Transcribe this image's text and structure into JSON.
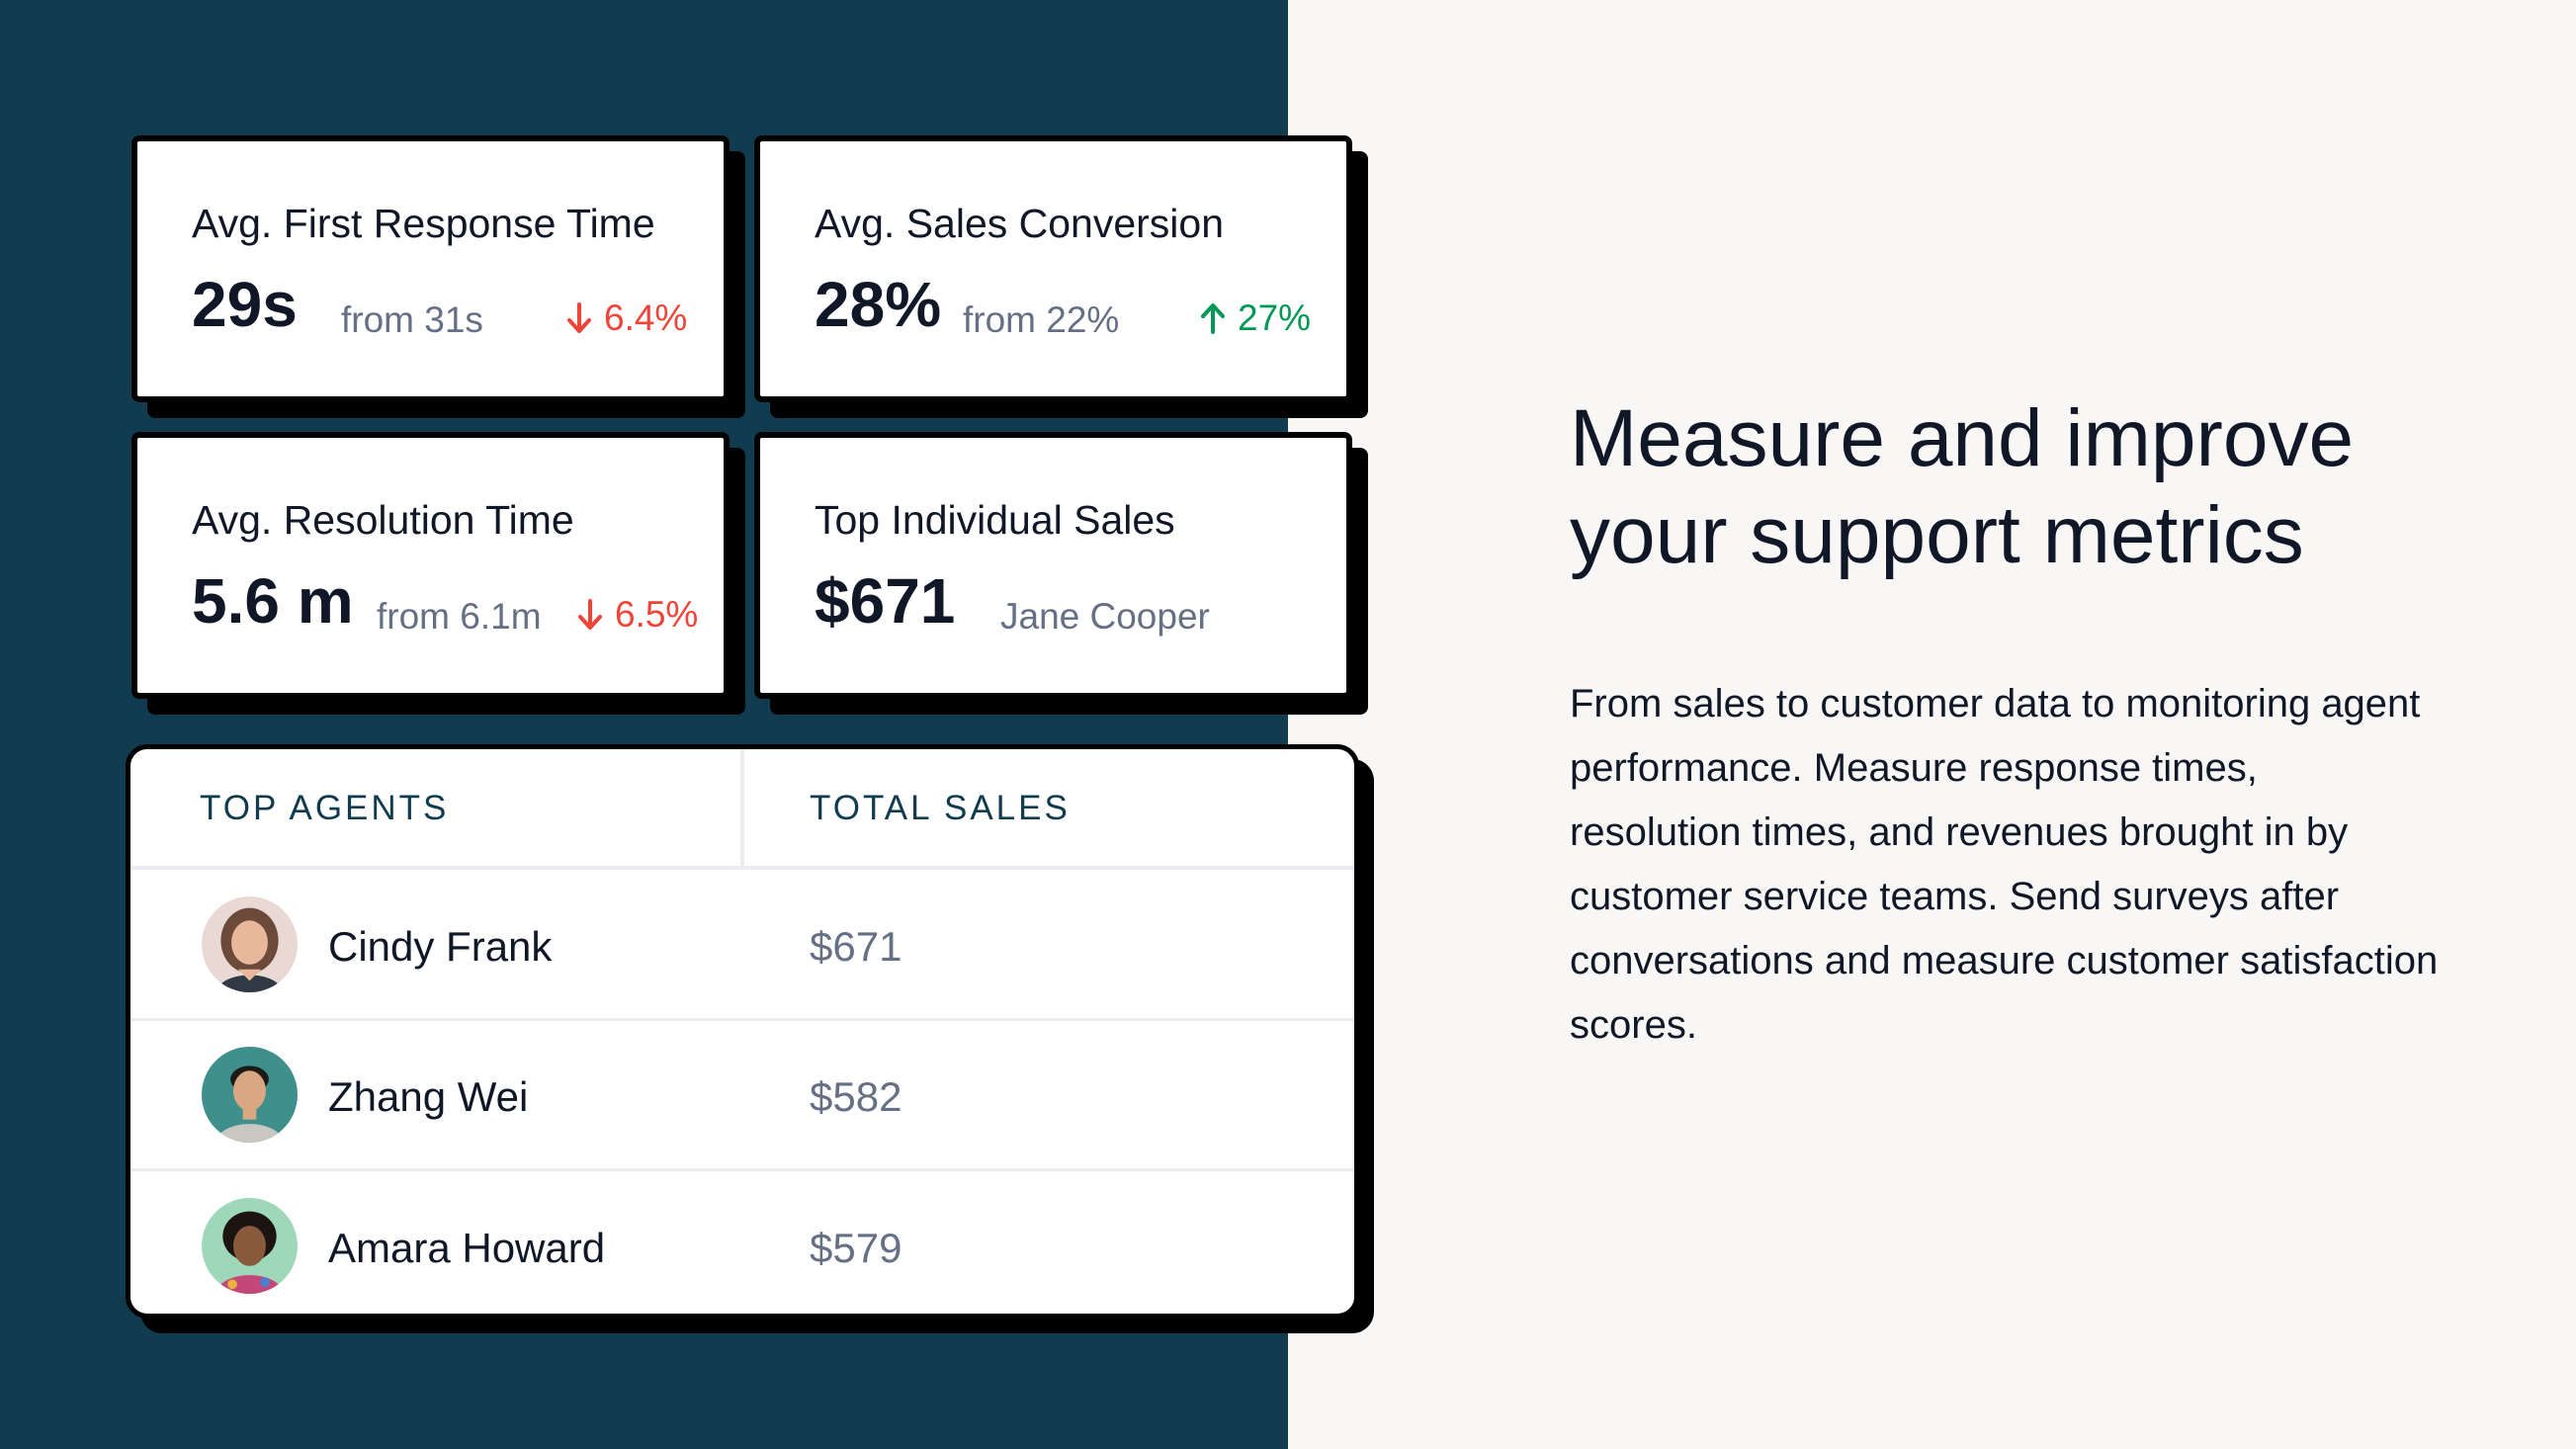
{
  "metrics": {
    "first_response": {
      "title": "Avg. First Response Time",
      "value": "29s",
      "from": "from 31s",
      "delta": "6.4%",
      "direction": "down"
    },
    "sales_conversion": {
      "title": "Avg. Sales Conversion",
      "value": "28%",
      "from": "from 22%",
      "delta": "27%",
      "direction": "up"
    },
    "resolution": {
      "title": "Avg. Resolution Time",
      "value": "5.6 m",
      "from": "from 6.1m",
      "delta": "6.5%",
      "direction": "down"
    },
    "top_sales": {
      "title": "Top Individual Sales",
      "value": "$671",
      "name": "Jane Cooper"
    }
  },
  "table": {
    "headers": {
      "agents": "TOP AGENTS",
      "sales": "TOTAL SALES"
    },
    "rows": [
      {
        "name": "Cindy Frank",
        "sales": "$671",
        "avatar": "woman-portrait-avatar"
      },
      {
        "name": "Zhang Wei",
        "sales": "$582",
        "avatar": "man-portrait-avatar"
      },
      {
        "name": "Amara Howard",
        "sales": "$579",
        "avatar": "woman-portrait-avatar"
      }
    ]
  },
  "hero": {
    "headline": "Measure and improve your support metrics",
    "body": "From sales to customer data to monitoring agent performance. Measure response times, resolution times, and revenues brought in by customer service teams. Send surveys after conversations and measure customer satisfaction scores."
  },
  "colors": {
    "panel": "#113c50",
    "background": "#f8f7f6",
    "down": "#f04438",
    "up": "#039855"
  }
}
